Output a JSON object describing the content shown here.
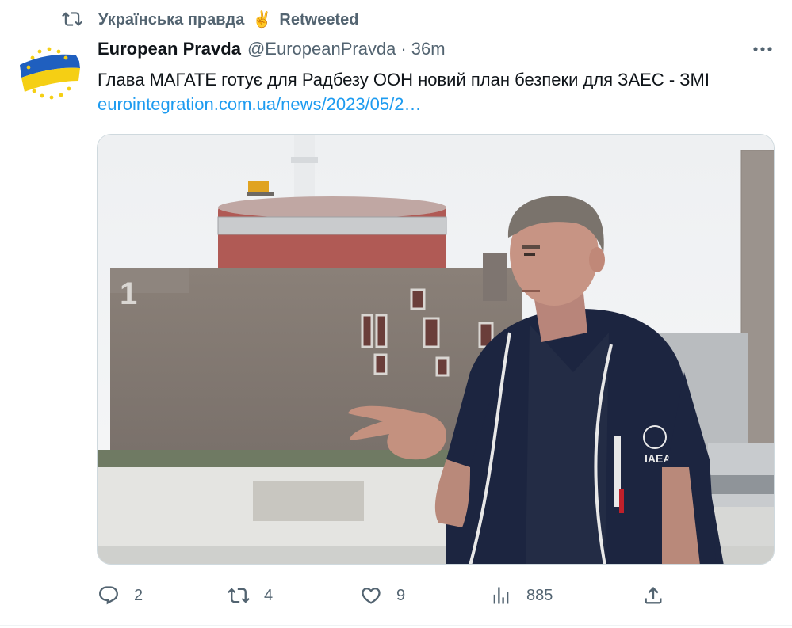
{
  "retweet": {
    "icon": "retweet-icon",
    "account": "Українська правда",
    "emoji": "✌️",
    "label": "Retweeted"
  },
  "tweet": {
    "author_name": "European Pravda",
    "handle": "@EuropeanPravda",
    "separator": "·",
    "time": "36m",
    "text": "Глава МАГАТЕ готує для Радбезу ООН новий план безпеки для ЗАЕС - ЗМІ",
    "link": "eurointegration.com.ua/news/2023/05/2…",
    "media_lettering": {
      "reactor_number": "1",
      "vest_logo": "IAEA"
    }
  },
  "actions": {
    "reply": {
      "icon": "reply-icon",
      "count": "2"
    },
    "retweet": {
      "icon": "retweet-icon",
      "count": "4"
    },
    "like": {
      "icon": "heart-icon",
      "count": "9"
    },
    "views": {
      "icon": "analytics-icon",
      "count": "885"
    },
    "share": {
      "icon": "share-icon"
    }
  },
  "colors": {
    "text_primary": "#0f1419",
    "text_secondary": "#536471",
    "link": "#1d9bf0",
    "flag_blue": "#1f5fbf",
    "flag_yellow": "#f5cf14"
  }
}
